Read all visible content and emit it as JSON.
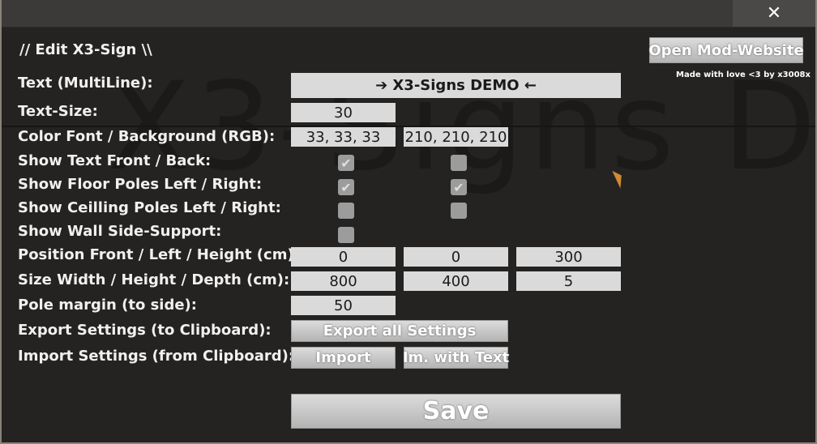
{
  "window": {
    "close_icon": "✕"
  },
  "title": "//   Edit X3-Sign   \\\\",
  "open_mod_button": "Open Mod-Website",
  "note": "Made with love <3 by x3008x",
  "background_text": "X3-Signs D",
  "labels": {
    "text": "Text (MultiLine):",
    "text_size": "Text-Size:",
    "color": "Color Font / Background (RGB):",
    "show_text": "Show Text Front / Back:",
    "floor_poles": "Show Floor Poles Left / Right:",
    "ceiling_poles": "Show Ceilling Poles Left / Right:",
    "wall_support": "Show Wall Side-Support:",
    "position": "Position Front / Left / Height (cm):",
    "size": "Size Width / Height / Depth (cm):",
    "pole_margin": "Pole margin (to side):",
    "export": "Export Settings (to Clipboard):",
    "import": "Import Settings (from Clipboard):"
  },
  "values": {
    "text": "➔ X3-Signs DEMO ←",
    "text_size": "30",
    "color_font": "33, 33, 33",
    "color_background": "210, 210, 210",
    "position_front": "0",
    "position_left": "0",
    "position_height": "300",
    "size_width": "800",
    "size_height": "400",
    "size_depth": "5",
    "pole_margin": "50"
  },
  "checkboxes": {
    "show_text_front": true,
    "show_text_back": false,
    "floor_pole_left": true,
    "floor_pole_right": true,
    "ceiling_pole_left": false,
    "ceiling_pole_right": false,
    "wall_support": false,
    "check_glyph": "✔"
  },
  "buttons": {
    "export_all": "Export all Settings",
    "import": "Import",
    "import_with_text": "Im. with Text",
    "save": "Save"
  },
  "colors": {
    "panel": "#242322",
    "field": "#dadada",
    "accent_cursor": "#d28a32"
  }
}
